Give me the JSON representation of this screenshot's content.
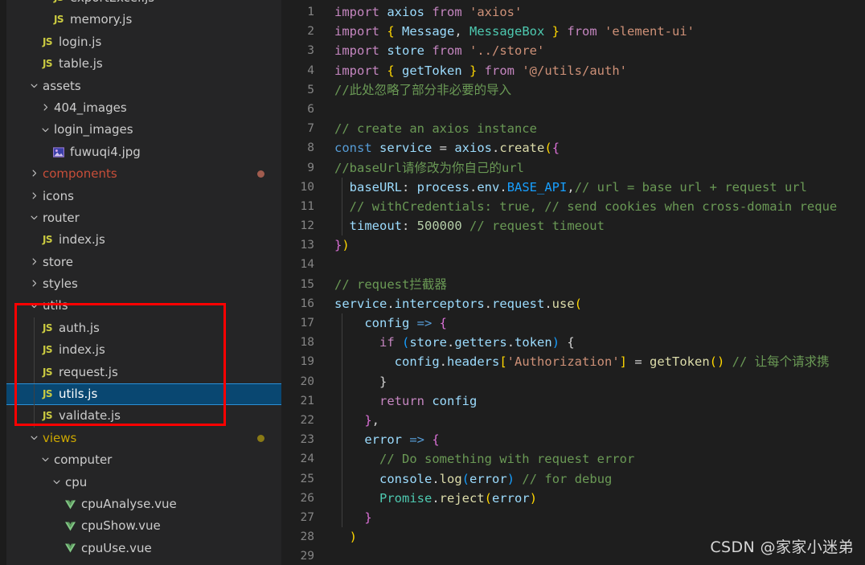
{
  "sidebar": {
    "background": "#252526",
    "selected_background": "#094771",
    "tree": [
      {
        "label": "exportExcel.js",
        "kind": "file",
        "icon": "js-file-icon",
        "depth": 3,
        "chevron": "none",
        "clipped_top": true
      },
      {
        "label": "memory.js",
        "kind": "file",
        "icon": "js-file-icon",
        "depth": 3,
        "chevron": "none"
      },
      {
        "label": "login.js",
        "kind": "file",
        "icon": "js-file-icon",
        "depth": 2,
        "chevron": "none"
      },
      {
        "label": "table.js",
        "kind": "file",
        "icon": "js-file-icon",
        "depth": 2,
        "chevron": "none"
      },
      {
        "label": "assets",
        "kind": "folder",
        "icon": "chevron-down-icon",
        "depth": 1,
        "chevron": "down"
      },
      {
        "label": "404_images",
        "kind": "folder",
        "icon": "chevron-right-icon",
        "depth": 2,
        "chevron": "right"
      },
      {
        "label": "login_images",
        "kind": "folder",
        "icon": "chevron-down-icon",
        "depth": 2,
        "chevron": "down"
      },
      {
        "label": "fuwuqi4.jpg",
        "kind": "file",
        "icon": "image-file-icon",
        "depth": 3,
        "chevron": "none"
      },
      {
        "label": "components",
        "kind": "folder",
        "icon": "chevron-right-icon",
        "depth": 1,
        "chevron": "right",
        "modified": "red",
        "dot_color": "#a15c4e"
      },
      {
        "label": "icons",
        "kind": "folder",
        "icon": "chevron-right-icon",
        "depth": 1,
        "chevron": "right"
      },
      {
        "label": "router",
        "kind": "folder",
        "icon": "chevron-down-icon",
        "depth": 1,
        "chevron": "down"
      },
      {
        "label": "index.js",
        "kind": "file",
        "icon": "js-file-icon",
        "depth": 2,
        "chevron": "none"
      },
      {
        "label": "store",
        "kind": "folder",
        "icon": "chevron-right-icon",
        "depth": 1,
        "chevron": "right"
      },
      {
        "label": "styles",
        "kind": "folder",
        "icon": "chevron-right-icon",
        "depth": 1,
        "chevron": "right"
      },
      {
        "label": "utils",
        "kind": "folder",
        "icon": "chevron-down-icon",
        "depth": 1,
        "chevron": "down"
      },
      {
        "label": "auth.js",
        "kind": "file",
        "icon": "js-file-icon",
        "depth": 2,
        "chevron": "none",
        "guide": true
      },
      {
        "label": "index.js",
        "kind": "file",
        "icon": "js-file-icon",
        "depth": 2,
        "chevron": "none",
        "guide": true
      },
      {
        "label": "request.js",
        "kind": "file",
        "icon": "js-file-icon",
        "depth": 2,
        "chevron": "none",
        "guide": true
      },
      {
        "label": "utils.js",
        "kind": "file",
        "icon": "js-file-icon",
        "depth": 2,
        "chevron": "none",
        "guide": true,
        "selected": true
      },
      {
        "label": "validate.js",
        "kind": "file",
        "icon": "js-file-icon",
        "depth": 2,
        "chevron": "none",
        "guide": true
      },
      {
        "label": "views",
        "kind": "folder",
        "icon": "chevron-down-icon",
        "depth": 1,
        "chevron": "down",
        "modified": "yellow",
        "dot_color": "#8a7a15"
      },
      {
        "label": "computer",
        "kind": "folder",
        "icon": "chevron-down-icon",
        "depth": 2,
        "chevron": "down"
      },
      {
        "label": "cpu",
        "kind": "folder",
        "icon": "chevron-down-icon",
        "depth": 3,
        "chevron": "down"
      },
      {
        "label": "cpuAnalyse.vue",
        "kind": "file",
        "icon": "vue-file-icon",
        "depth": 4,
        "chevron": "none"
      },
      {
        "label": "cpuShow.vue",
        "kind": "file",
        "icon": "vue-file-icon",
        "depth": 4,
        "chevron": "none"
      },
      {
        "label": "cpuUse.vue",
        "kind": "file",
        "icon": "vue-file-icon",
        "depth": 4,
        "chevron": "none"
      }
    ]
  },
  "annotation": {
    "shape": "rectangle",
    "color": "#ff0000",
    "encloses": "utils folder and its files auth.js, index.js, request.js, utils.js"
  },
  "editor": {
    "background": "#1e1e1e",
    "first_line_number": 1,
    "lines": [
      {
        "num": 1,
        "tokens": [
          {
            "t": "import ",
            "c": "k"
          },
          {
            "t": "axios ",
            "c": "v"
          },
          {
            "t": "from ",
            "c": "k"
          },
          {
            "t": "'axios'",
            "c": "s"
          }
        ]
      },
      {
        "num": 2,
        "tokens": [
          {
            "t": "import ",
            "c": "k"
          },
          {
            "t": "{",
            "c": "b1"
          },
          {
            "t": " ",
            "c": "p"
          },
          {
            "t": "Message",
            "c": "v"
          },
          {
            "t": ", ",
            "c": "p"
          },
          {
            "t": "MessageBox ",
            "c": "cls"
          },
          {
            "t": "}",
            "c": "b1"
          },
          {
            "t": " ",
            "c": "p"
          },
          {
            "t": "from ",
            "c": "k"
          },
          {
            "t": "'element-ui'",
            "c": "s"
          }
        ]
      },
      {
        "num": 3,
        "tokens": [
          {
            "t": "import ",
            "c": "k"
          },
          {
            "t": "store ",
            "c": "v"
          },
          {
            "t": "from ",
            "c": "k"
          },
          {
            "t": "'../store'",
            "c": "s"
          }
        ]
      },
      {
        "num": 4,
        "tokens": [
          {
            "t": "import ",
            "c": "k"
          },
          {
            "t": "{ ",
            "c": "b1"
          },
          {
            "t": "getToken",
            "c": "v"
          },
          {
            "t": " }",
            "c": "b1"
          },
          {
            "t": " ",
            "c": "p"
          },
          {
            "t": "from ",
            "c": "k"
          },
          {
            "t": "'@/utils/auth'",
            "c": "s"
          }
        ]
      },
      {
        "num": 5,
        "tokens": [
          {
            "t": "//此处忽略了部分非必要的导入",
            "c": "c"
          }
        ]
      },
      {
        "num": 6,
        "tokens": []
      },
      {
        "num": 7,
        "tokens": [
          {
            "t": "// create an axios instance",
            "c": "c"
          }
        ]
      },
      {
        "num": 8,
        "tokens": [
          {
            "t": "const ",
            "c": "k2"
          },
          {
            "t": "service ",
            "c": "v"
          },
          {
            "t": "= ",
            "c": "p"
          },
          {
            "t": "axios",
            "c": "v"
          },
          {
            "t": ".",
            "c": "p"
          },
          {
            "t": "create",
            "c": "f"
          },
          {
            "t": "(",
            "c": "b1"
          },
          {
            "t": "{",
            "c": "b2"
          }
        ]
      },
      {
        "num": 9,
        "tokens": [
          {
            "t": "//baseUrl请修改为你自己的url",
            "c": "c"
          }
        ]
      },
      {
        "num": 10,
        "indent": 1,
        "tokens": [
          {
            "t": "  baseURL",
            "c": "v"
          },
          {
            "t": ": ",
            "c": "p"
          },
          {
            "t": "process",
            "c": "v"
          },
          {
            "t": ".",
            "c": "p"
          },
          {
            "t": "env",
            "c": "v"
          },
          {
            "t": ".",
            "c": "p"
          },
          {
            "t": "BASE_API",
            "c": "b3"
          },
          {
            "t": ",",
            "c": "p"
          },
          {
            "t": "// url = base url + request url",
            "c": "c"
          }
        ]
      },
      {
        "num": 11,
        "indent": 1,
        "tokens": [
          {
            "t": "  // withCredentials: true, // send cookies when cross-domain reque",
            "c": "c"
          }
        ]
      },
      {
        "num": 12,
        "indent": 1,
        "tokens": [
          {
            "t": "  timeout",
            "c": "v"
          },
          {
            "t": ": ",
            "c": "p"
          },
          {
            "t": "500000 ",
            "c": "n"
          },
          {
            "t": "// request timeout",
            "c": "c"
          }
        ]
      },
      {
        "num": 13,
        "tokens": [
          {
            "t": "}",
            "c": "b2"
          },
          {
            "t": ")",
            "c": "b1"
          }
        ]
      },
      {
        "num": 14,
        "tokens": []
      },
      {
        "num": 15,
        "tokens": [
          {
            "t": "// request拦截器",
            "c": "c"
          }
        ]
      },
      {
        "num": 16,
        "tokens": [
          {
            "t": "service",
            "c": "v"
          },
          {
            "t": ".",
            "c": "p"
          },
          {
            "t": "interceptors",
            "c": "v"
          },
          {
            "t": ".",
            "c": "p"
          },
          {
            "t": "request",
            "c": "v"
          },
          {
            "t": ".",
            "c": "p"
          },
          {
            "t": "use",
            "c": "f"
          },
          {
            "t": "(",
            "c": "b1"
          }
        ]
      },
      {
        "num": 17,
        "indent": 1,
        "tokens": [
          {
            "t": "    config ",
            "c": "v"
          },
          {
            "t": "=> ",
            "c": "k2"
          },
          {
            "t": "{",
            "c": "b2"
          }
        ]
      },
      {
        "num": 18,
        "indent": 1,
        "tokens": [
          {
            "t": "      ",
            "c": "p"
          },
          {
            "t": "if ",
            "c": "k"
          },
          {
            "t": "(",
            "c": "b3"
          },
          {
            "t": "store",
            "c": "v"
          },
          {
            "t": ".",
            "c": "p"
          },
          {
            "t": "getters",
            "c": "v"
          },
          {
            "t": ".",
            "c": "p"
          },
          {
            "t": "token",
            "c": "v"
          },
          {
            "t": ")",
            "c": "b3"
          },
          {
            "t": " {",
            "c": "p"
          }
        ]
      },
      {
        "num": 19,
        "indent": 1,
        "tokens": [
          {
            "t": "        config",
            "c": "v"
          },
          {
            "t": ".",
            "c": "p"
          },
          {
            "t": "headers",
            "c": "v"
          },
          {
            "t": "[",
            "c": "b1"
          },
          {
            "t": "'Authorization'",
            "c": "s"
          },
          {
            "t": "]",
            "c": "b1"
          },
          {
            "t": " = ",
            "c": "p"
          },
          {
            "t": "getToken",
            "c": "f"
          },
          {
            "t": "()",
            "c": "b1"
          },
          {
            "t": " ",
            "c": "p"
          },
          {
            "t": "// 让每个请求携",
            "c": "c"
          }
        ]
      },
      {
        "num": 20,
        "indent": 1,
        "tokens": [
          {
            "t": "      }",
            "c": "p"
          }
        ]
      },
      {
        "num": 21,
        "indent": 1,
        "tokens": [
          {
            "t": "      ",
            "c": "p"
          },
          {
            "t": "return ",
            "c": "k"
          },
          {
            "t": "config",
            "c": "v"
          }
        ]
      },
      {
        "num": 22,
        "indent": 1,
        "tokens": [
          {
            "t": "    }",
            "c": "b2"
          },
          {
            "t": ",",
            "c": "p"
          }
        ]
      },
      {
        "num": 23,
        "indent": 1,
        "tokens": [
          {
            "t": "    error ",
            "c": "v"
          },
          {
            "t": "=> ",
            "c": "k2"
          },
          {
            "t": "{",
            "c": "b2"
          }
        ]
      },
      {
        "num": 24,
        "indent": 1,
        "tokens": [
          {
            "t": "      // Do something with request error",
            "c": "c"
          }
        ]
      },
      {
        "num": 25,
        "indent": 1,
        "tokens": [
          {
            "t": "      console",
            "c": "v"
          },
          {
            "t": ".",
            "c": "p"
          },
          {
            "t": "log",
            "c": "f"
          },
          {
            "t": "(",
            "c": "b3"
          },
          {
            "t": "error",
            "c": "v"
          },
          {
            "t": ")",
            "c": "b3"
          },
          {
            "t": " ",
            "c": "p"
          },
          {
            "t": "// for debug",
            "c": "c"
          }
        ]
      },
      {
        "num": 26,
        "indent": 1,
        "tokens": [
          {
            "t": "      Promise",
            "c": "cls"
          },
          {
            "t": ".",
            "c": "p"
          },
          {
            "t": "reject",
            "c": "f"
          },
          {
            "t": "(",
            "c": "b1"
          },
          {
            "t": "error",
            "c": "v"
          },
          {
            "t": ")",
            "c": "b1"
          }
        ]
      },
      {
        "num": 27,
        "indent": 1,
        "tokens": [
          {
            "t": "    }",
            "c": "b2"
          }
        ]
      },
      {
        "num": 28,
        "tokens": [
          {
            "t": "  )",
            "c": "b1"
          }
        ]
      },
      {
        "num": 29,
        "tokens": []
      }
    ]
  },
  "watermark": {
    "text": "CSDN @家家小迷弟"
  }
}
